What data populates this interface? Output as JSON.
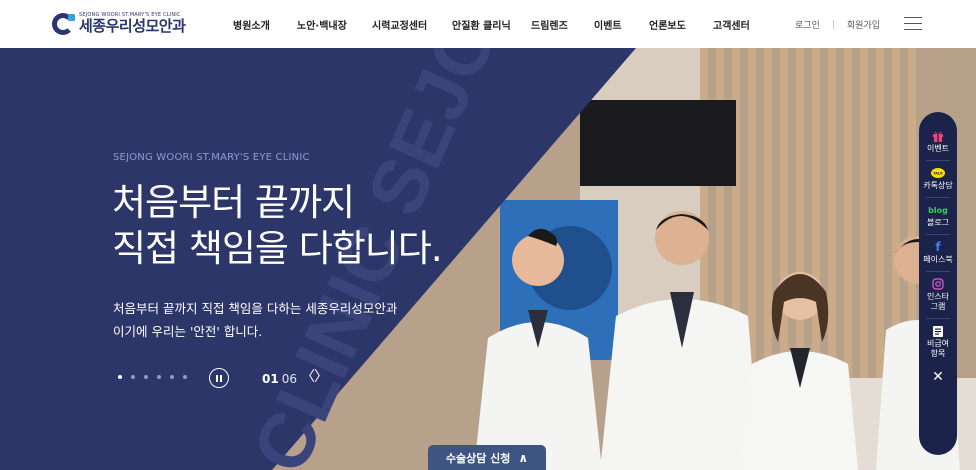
{
  "brand": {
    "sub": "SEJONG WOORI ST.MARY'S EYE CLINIC",
    "name": "세종우리성모안과"
  },
  "nav": [
    "병원소개",
    "노안·백내장",
    "시력교정센터",
    "안질환 클리닉",
    "드림렌즈",
    "이벤트",
    "언론보도",
    "고객센터"
  ],
  "util": {
    "login": "로그인",
    "signup": "회원가입",
    "sep": "|"
  },
  "hero": {
    "eyebrow": "SEJONG WOORI ST.MARY'S EYE CLINIC",
    "headline": "처음부터 끝까지\n직접 책임을 다합니다.",
    "desc": "처음부터 끝까지 직접 책임을 다하는 세종우리성모안과\n이기에 우리는 '안전' 합니다.",
    "watermark": "CLINIC SEJONG",
    "slide_current": "01",
    "slide_total": "06",
    "slide_count": 6,
    "active_index": 0
  },
  "consult": {
    "label": "수술상담 신청",
    "arrow": "∧"
  },
  "quick": [
    {
      "icon": "gift-icon",
      "glyph": "🎁",
      "label": "이벤트",
      "color": "#e8457a"
    },
    {
      "icon": "kakao-icon",
      "glyph": "TALK",
      "label": "카톡상담",
      "color": "#f9e000"
    },
    {
      "icon": "blog-icon",
      "glyph": "blog",
      "label": "블로그",
      "color": "#2fd15c"
    },
    {
      "icon": "facebook-icon",
      "glyph": "f",
      "label": "페이스북",
      "color": "#4a7bf0"
    },
    {
      "icon": "instagram-icon",
      "glyph": "◎",
      "label": "인스타\n그램",
      "color": "#c154c1"
    },
    {
      "icon": "price-list-icon",
      "glyph": "▤",
      "label": "비급여\n항목",
      "color": "#ffffff"
    }
  ],
  "colors": {
    "navy": "#2d3669",
    "navy_dark": "#1c234a",
    "accent": "#3aa3d9"
  }
}
